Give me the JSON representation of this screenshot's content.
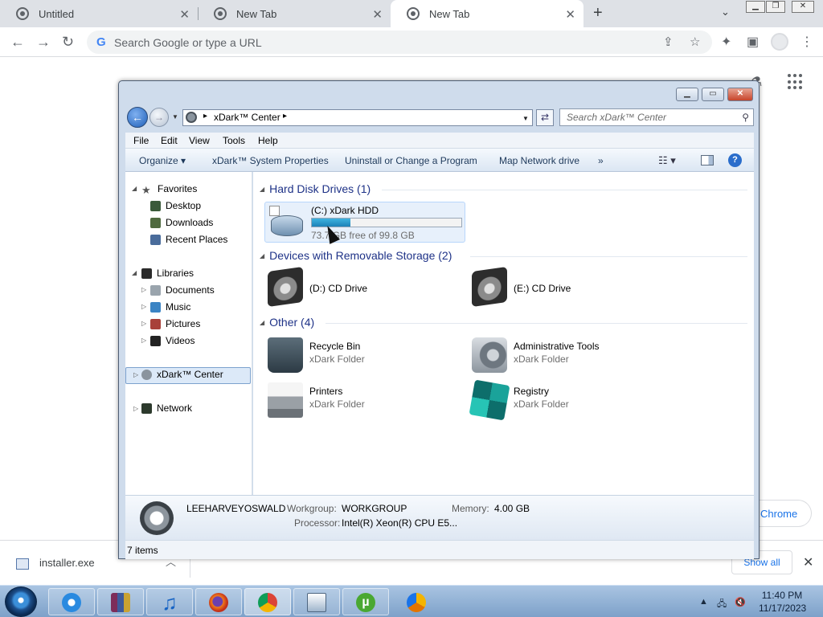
{
  "chrome": {
    "tabs": [
      {
        "title": "Untitled",
        "active": false
      },
      {
        "title": "New Tab",
        "active": false
      },
      {
        "title": "New Tab",
        "active": true
      }
    ],
    "omnibox": {
      "placeholder": "Search Google or type a URL"
    },
    "chrome_chip": "Chrome"
  },
  "download_bar": {
    "file_name": "installer.exe",
    "show_all": "Show all"
  },
  "xdark": {
    "address": "xDark™ Center",
    "search_placeholder": "Search xDark™ Center",
    "menu": [
      "File",
      "Edit",
      "View",
      "Tools",
      "Help"
    ],
    "commands": [
      "Organize",
      "xDark™ System Properties",
      "Uninstall or Change a Program",
      "Map Network drive",
      "»"
    ],
    "nav": {
      "favorites": {
        "label": "Favorites",
        "items": [
          "Desktop",
          "Downloads",
          "Recent Places"
        ]
      },
      "libraries": {
        "label": "Libraries",
        "items": [
          "Documents",
          "Music",
          "Pictures",
          "Videos"
        ]
      },
      "center": "xDark™ Center",
      "network": "Network"
    },
    "groups": {
      "hdd": {
        "header": "Hard Disk Drives (1)",
        "drive": {
          "name": "(C:) xDark HDD",
          "free_text": "73.7 GB free of 99.8 GB",
          "used_fraction": 0.26
        }
      },
      "removable": {
        "header": "Devices with Removable Storage (2)",
        "items": [
          {
            "name": "(D:) CD Drive"
          },
          {
            "name": "(E:) CD Drive"
          }
        ]
      },
      "other": {
        "header": "Other (4)",
        "items": [
          {
            "name": "Recycle Bin",
            "type": "xDark Folder",
            "icon": "recycle-bin-icon"
          },
          {
            "name": "Administrative Tools",
            "type": "xDark Folder",
            "icon": "admin-tools-icon"
          },
          {
            "name": "Printers",
            "type": "xDark Folder",
            "icon": "printer-icon"
          },
          {
            "name": "Registry",
            "type": "xDark Folder",
            "icon": "registry-icon"
          }
        ]
      }
    },
    "details": {
      "computer": "LEEHARVEYOSWALD",
      "workgroup_label": "Workgroup:",
      "workgroup": "WORKGROUP",
      "memory_label": "Memory:",
      "memory": "4.00 GB",
      "processor_label": "Processor:",
      "processor": "Intel(R) Xeon(R) CPU E5..."
    },
    "status": "7 items"
  },
  "taskbar": {
    "apps": [
      "internet-explorer",
      "winrar",
      "itunes",
      "firefox",
      "chrome",
      "notepad",
      "utorrent",
      "chrome-canary"
    ],
    "time": "11:40 PM",
    "date": "11/17/2023"
  }
}
